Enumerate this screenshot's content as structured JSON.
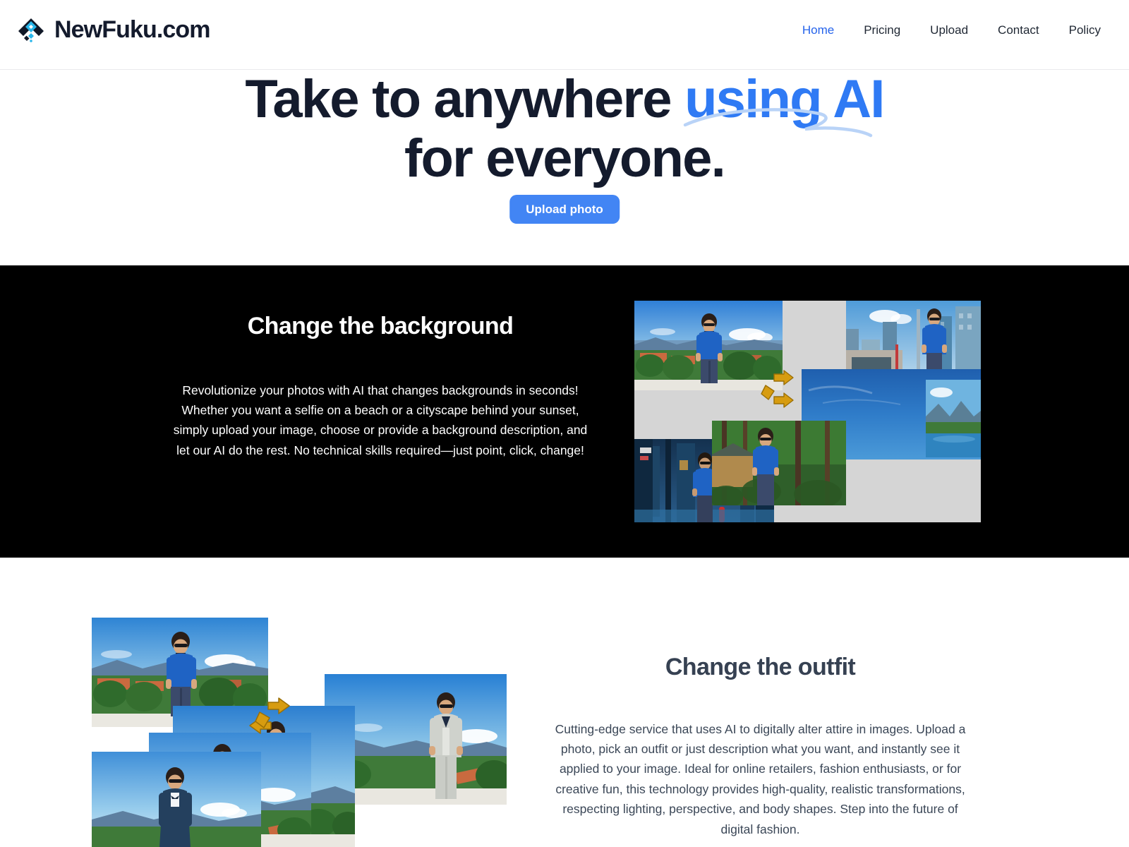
{
  "brand": {
    "name": "NewFuku.com",
    "logo_icon": "chevron-diamond-logo-icon",
    "logo_colors": {
      "dark": "#101827",
      "accent": "#29b6ea"
    }
  },
  "nav": {
    "items": [
      {
        "label": "Home",
        "active": true
      },
      {
        "label": "Pricing",
        "active": false
      },
      {
        "label": "Upload",
        "active": false
      },
      {
        "label": "Contact",
        "active": false
      },
      {
        "label": "Policy",
        "active": false
      }
    ],
    "active_color": "#2563eb",
    "default_color": "#1f2733"
  },
  "hero": {
    "title_part1": "Take to anywhere ",
    "title_accent": "using AI",
    "title_line2": "for everyone.",
    "accent_color": "#2f7af4",
    "swoosh_color": "#b9d3f7",
    "cta_label": "Upload photo",
    "cta_bg": "#4285f4",
    "cta_text_color": "#ffffff"
  },
  "section_background": {
    "title": "Change the background",
    "body": "Revolutionize your photos with AI that changes backgrounds in seconds! Whether you want a selfie on a beach or a cityscape behind your sunset, simply upload your image, choose or provide a background description, and let our AI do the rest. No technical skills required—just point, click, change!",
    "bg_color": "#000000",
    "text_color": "#ffffff",
    "collage": {
      "panel_color": "#d5d5d5",
      "swap_icon": "swap-arrows-icon",
      "swap_icon_color": "#d79c10",
      "photos": [
        {
          "name": "photo-hillside-city",
          "caption": "Man in blue t-shirt on a hillside overlooking a city"
        },
        {
          "name": "photo-downtown-street",
          "caption": "Man in blue t-shirt on a downtown street with skyscrapers"
        },
        {
          "name": "photo-open-sky",
          "caption": "Man in blue t-shirt against an open blue sky"
        },
        {
          "name": "photo-mountain-lake",
          "caption": "Man in blue t-shirt by a mountain lake"
        },
        {
          "name": "photo-neon-alley",
          "caption": "Man in blue t-shirt in a neon-lit alley"
        },
        {
          "name": "photo-forest-cabin",
          "caption": "Man in blue t-shirt in a forest beside a cabin"
        }
      ]
    }
  },
  "section_outfit": {
    "title": "Change the outfit",
    "body": "Cutting-edge service that uses AI to digitally alter attire in images. Upload a photo, pick an outfit or just description what you want, and instantly see it applied to your image. Ideal for online retailers, fashion enthusiasts, or for creative fun, this technology provides high-quality, realistic transformations, respecting lighting, perspective, and body shapes. Step into the future of digital fashion.",
    "bg_color": "#ffffff",
    "title_color": "#364152",
    "text_color": "#3b4757",
    "collage": {
      "swap_icon": "swap-arrows-icon",
      "swap_icon_color": "#d79c10",
      "photos": [
        {
          "name": "photo-outfit-blue-tshirt",
          "caption": "Man in blue t-shirt on hillside"
        },
        {
          "name": "photo-outfit-grey-suit",
          "caption": "Man in light grey three-piece suit"
        },
        {
          "name": "photo-outfit-teal-blazer",
          "caption": "Man in teal blazer and tan trousers"
        },
        {
          "name": "photo-outfit-denim-jacket",
          "caption": "Man in denim jacket and tie"
        },
        {
          "name": "photo-outfit-navy-suit",
          "caption": "Man in navy suit with bow tie"
        }
      ]
    }
  }
}
